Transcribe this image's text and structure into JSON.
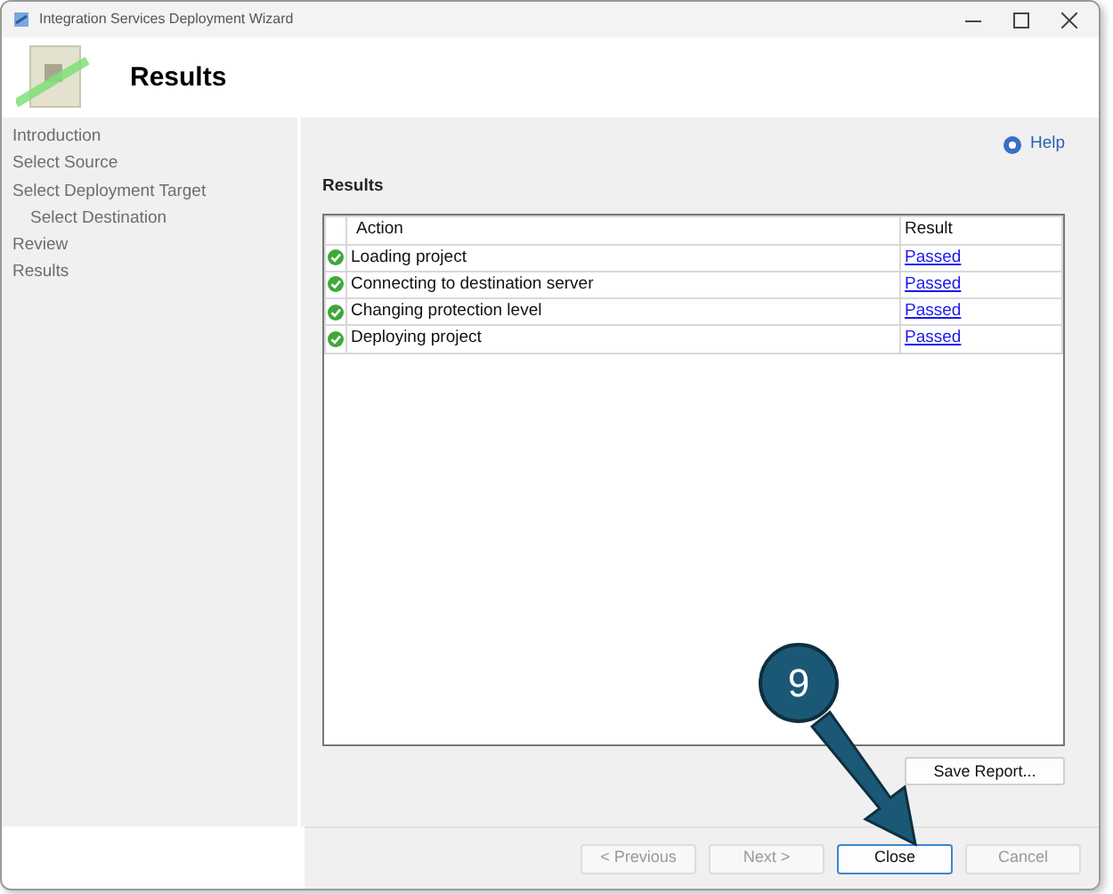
{
  "window": {
    "title": "Integration Services Deployment Wizard"
  },
  "header": {
    "title": "Results"
  },
  "sidebar": {
    "items": [
      {
        "label": "Introduction"
      },
      {
        "label": "Select Source"
      },
      {
        "label": "Select Deployment Target",
        "children": [
          {
            "label": "Select Destination"
          }
        ]
      },
      {
        "label": "Review"
      },
      {
        "label": "Results"
      }
    ]
  },
  "help": {
    "label": "Help"
  },
  "section_title": "Results",
  "table": {
    "columns": [
      "Action",
      "Result"
    ],
    "rows": [
      {
        "action": "Loading project",
        "result": "Passed"
      },
      {
        "action": "Connecting to destination server",
        "result": "Passed"
      },
      {
        "action": "Changing protection level",
        "result": "Passed"
      },
      {
        "action": "Deploying project",
        "result": "Passed"
      }
    ]
  },
  "save_report": {
    "label": "Save Report..."
  },
  "buttons": [
    {
      "label": "< Previous",
      "disabled": true
    },
    {
      "label": "Next >",
      "disabled": true
    },
    {
      "label": "Close",
      "disabled": false
    },
    {
      "label": "Cancel",
      "disabled": true
    }
  ],
  "annotation": {
    "label": "9"
  }
}
